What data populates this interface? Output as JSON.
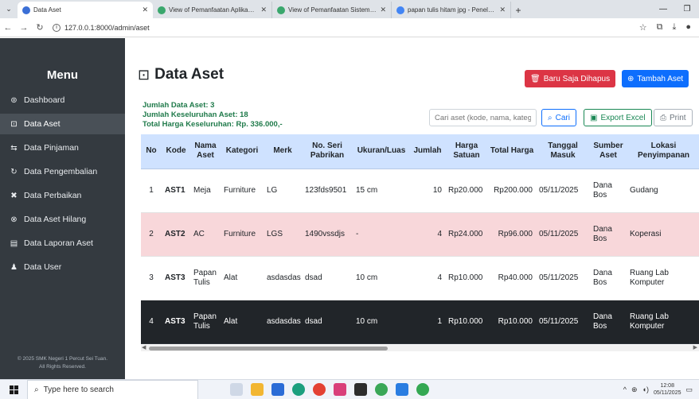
{
  "browser": {
    "tabs": [
      {
        "title": "Data Aset",
        "active": true,
        "favicon_color": "#3b6fd6"
      },
      {
        "title": "View of Pemanfaatan Aplikasi M",
        "active": false,
        "favicon_color": "#3aa76d"
      },
      {
        "title": "View of Pemanfaatan Sistem Inf",
        "active": false,
        "favicon_color": "#3aa76d"
      },
      {
        "title": "papan tulis hitam jpg - Penelusu",
        "active": false,
        "favicon_color": "#4285f4"
      }
    ],
    "url": "127.0.0.1:8000/admin/aset"
  },
  "sidebar": {
    "title": "Menu",
    "items": [
      {
        "label": "Dashboard",
        "icon": "dashboard-icon",
        "glyph": "⊚",
        "active": false
      },
      {
        "label": "Data Aset",
        "icon": "box-icon",
        "glyph": "⊡",
        "active": true
      },
      {
        "label": "Data Pinjaman",
        "icon": "swap-icon",
        "glyph": "⇆",
        "active": false
      },
      {
        "label": "Data Pengembalian",
        "icon": "return-icon",
        "glyph": "↻",
        "active": false
      },
      {
        "label": "Data Perbaikan",
        "icon": "tools-icon",
        "glyph": "✖",
        "active": false
      },
      {
        "label": "Data Aset Hilang",
        "icon": "x-circle-icon",
        "glyph": "⊗",
        "active": false
      },
      {
        "label": "Data Laporan Aset",
        "icon": "report-icon",
        "glyph": "▤",
        "active": false
      },
      {
        "label": "Data User",
        "icon": "users-icon",
        "glyph": "♟",
        "active": false
      }
    ],
    "footer_line1": "© 2025 SMK Negeri 1 Percut Sei Tuan.",
    "footer_line2": "All Rights Reserved."
  },
  "main": {
    "title": "Data Aset",
    "btn_deleted": "Baru Saja Dihapus",
    "btn_add": "Tambah Aset",
    "summary": {
      "total_assets": "Jumlah Data Aset: 3",
      "total_qty": "Jumlah Keseluruhan Aset: 18",
      "total_price": "Total Harga Keseluruhan: Rp. 336.000,-"
    },
    "search_placeholder": "Cari aset (kode, nama, kategori)",
    "btn_search": "Cari",
    "btn_export": "Export Excel",
    "btn_print": "Print"
  },
  "table": {
    "headers": [
      "No",
      "Kode",
      "Nama Aset",
      "Kategori",
      "Merk",
      "No. Seri Pabrikan",
      "Ukuran/Luas",
      "Jumlah",
      "Harga Satuan",
      "Total Harga",
      "Tanggal Masuk",
      "Sumber Aset",
      "Lokasi Penyimpanan"
    ],
    "rows": [
      {
        "style": "normal",
        "cells": [
          "1",
          "AST1",
          "Meja",
          "Furniture",
          "LG",
          "123fds9501",
          "15 cm",
          "10",
          "Rp20.000",
          "Rp200.000",
          "05/11/2025",
          "Dana Bos",
          "Gudang"
        ]
      },
      {
        "style": "danger",
        "cells": [
          "2",
          "AST2",
          "AC",
          "Furniture",
          "LGS",
          "1490vssdjs",
          "-",
          "4",
          "Rp24.000",
          "Rp96.000",
          "05/11/2025",
          "Dana Bos",
          "Koperasi"
        ]
      },
      {
        "style": "normal",
        "cells": [
          "3",
          "AST3",
          "Papan Tulis",
          "Alat",
          "asdasdas",
          "dsad",
          "10 cm",
          "4",
          "Rp10.000",
          "Rp40.000",
          "05/11/2025",
          "Dana Bos",
          "Ruang Lab Komputer"
        ]
      },
      {
        "style": "dark",
        "cells": [
          "4",
          "AST3",
          "Papan Tulis",
          "Alat",
          "asdasdas",
          "dsad",
          "10 cm",
          "1",
          "Rp10.000",
          "Rp10.000",
          "05/11/2025",
          "Dana Bos",
          "Ruang Lab Komputer"
        ]
      }
    ]
  },
  "taskbar": {
    "search_placeholder": "Type here to search",
    "time": "12:08",
    "date": "05/11/2025"
  }
}
